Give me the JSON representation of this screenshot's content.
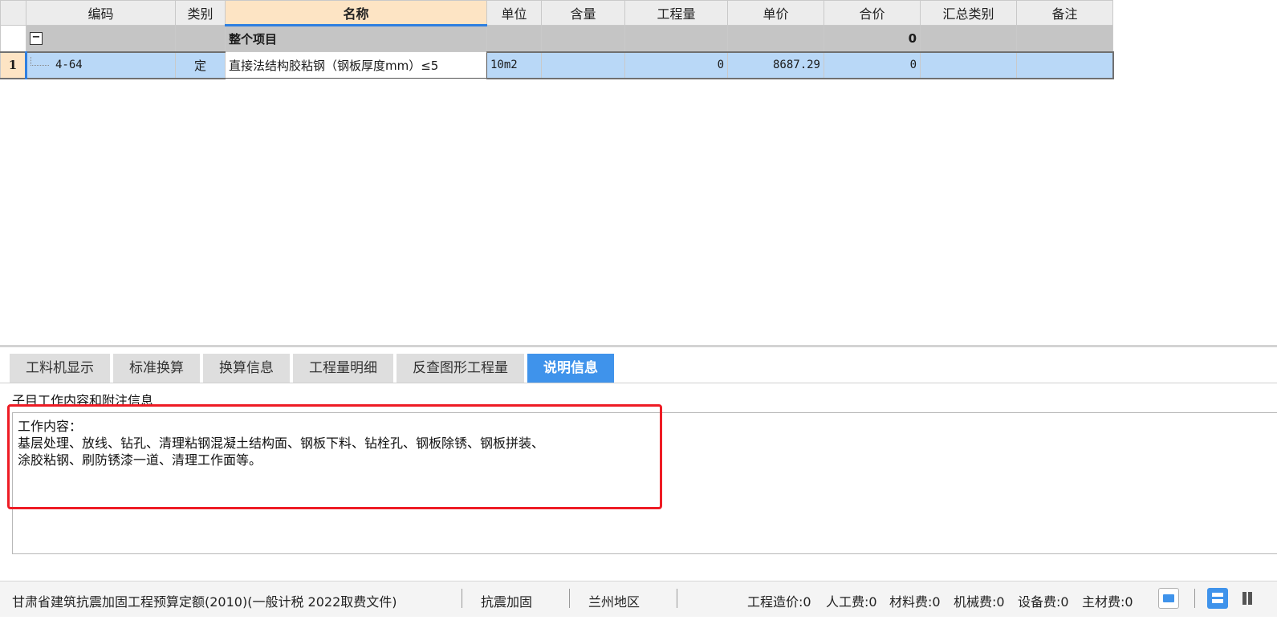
{
  "grid": {
    "headers": [
      "编码",
      "类别",
      "名称",
      "单位",
      "含量",
      "工程量",
      "单价",
      "合价",
      "汇总类别",
      "备注"
    ],
    "group_row": {
      "toggle": "−",
      "name": "整个项目",
      "total": "0"
    },
    "rows": [
      {
        "rownum": "1",
        "code": "4-64",
        "type": "定",
        "name": "直接法结构胶粘钢（钢板厚度mm）≤5",
        "unit": "10m2",
        "content": "",
        "quantity": "0",
        "unit_price": "8687.29",
        "total_price": "0",
        "summary_type": "",
        "remark": ""
      }
    ]
  },
  "tabs": [
    {
      "label": "工料机显示",
      "active": false
    },
    {
      "label": "标准换算",
      "active": false
    },
    {
      "label": "换算信息",
      "active": false
    },
    {
      "label": "工程量明细",
      "active": false
    },
    {
      "label": "反查图形工程量",
      "active": false
    },
    {
      "label": "说明信息",
      "active": true
    }
  ],
  "info": {
    "section_label": "子目工作内容和附注信息",
    "lines": [
      "工作内容：",
      "基层处理、放线、钻孔、清理粘钢混凝土结构面、钢板下料、钻栓孔、钢板除锈、钢板拼装、",
      "涂胶粘钢、刷防锈漆一道、清理工作面等。"
    ]
  },
  "statusbar": {
    "quota": "甘肃省建筑抗震加固工程预算定额(2010)(一般计税 2022取费文件)",
    "category": "抗震加固",
    "region": "兰州地区",
    "project_cost": "工程造价:0",
    "labor": "人工费:0",
    "material": "材料费:0",
    "machine": "机械费:0",
    "equipment": "设备费:0",
    "main_material": "主材费:0"
  },
  "colors": {
    "accent": "#3f93eb",
    "selected_row": "#b9d8f7",
    "header_highlight": "#fde4c4",
    "annotation": "#ee1c25"
  }
}
